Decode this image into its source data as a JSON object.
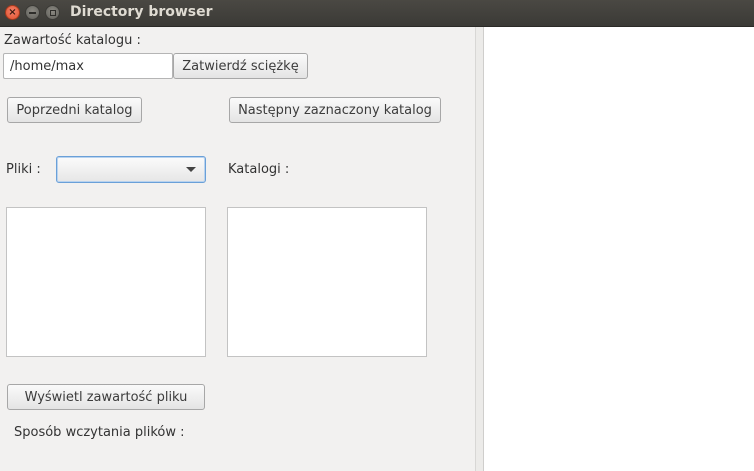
{
  "window": {
    "title": "Directory browser",
    "close_glyph": "×"
  },
  "left_panel": {
    "content_label": "Zawartość katalogu :",
    "path_input": {
      "value": "/home/max",
      "placeholder": ""
    },
    "confirm_path_label": "Zatwierdź sciężkę",
    "prev_dir_label": "Poprzedni katalog",
    "next_dir_label": "Następny zaznaczony katalog",
    "files_label": "Pliki :",
    "files_combo": {
      "selected": ""
    },
    "dirs_label": "Katalogi :",
    "show_file_label": "Wyświetl zawartość pliku",
    "read_mode_label": "Sposób wczytania plików :"
  },
  "colors": {
    "background": "#f2f1f0",
    "titlebar": "#3b3a36",
    "close_button": "#e0502c",
    "focus_ring": "#6aa0d8"
  }
}
